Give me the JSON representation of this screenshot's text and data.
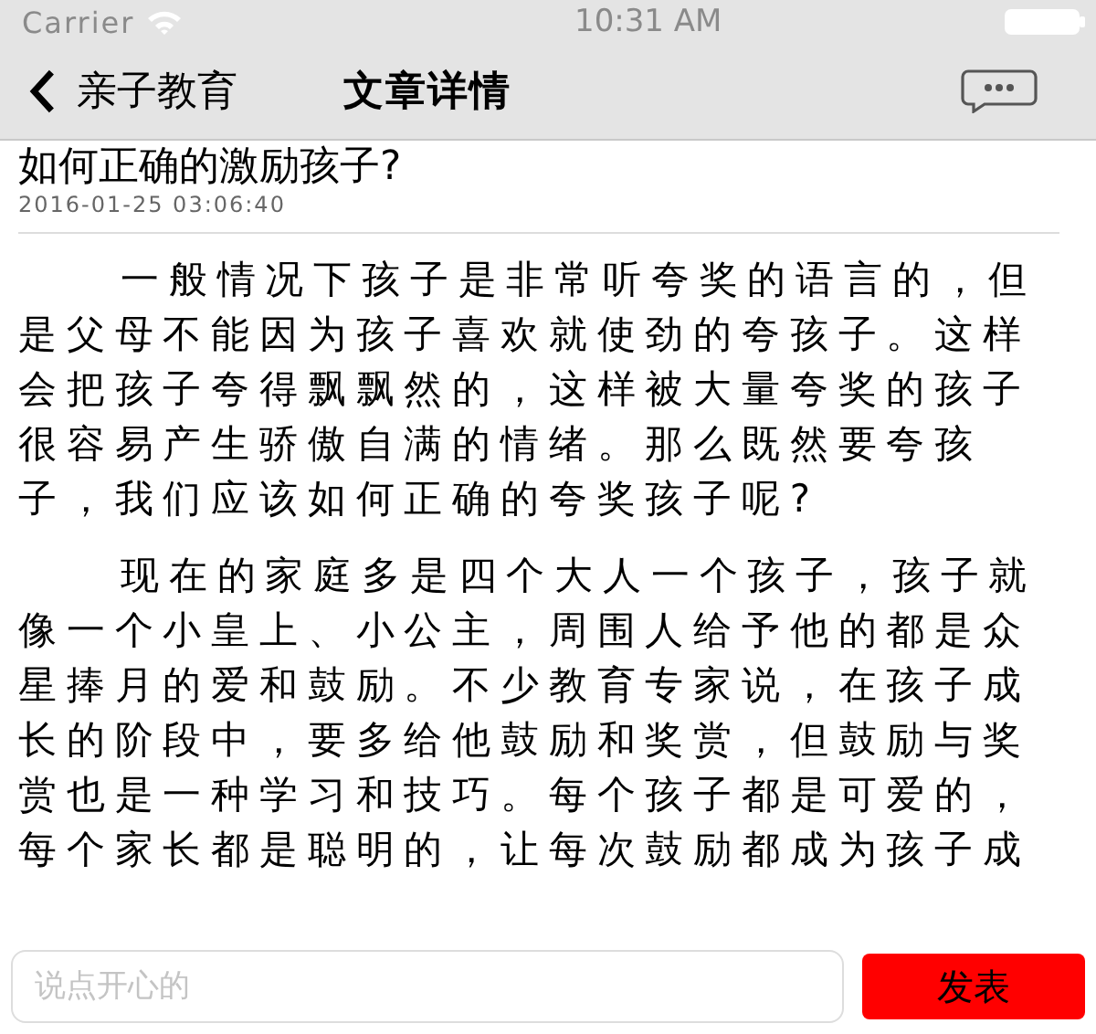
{
  "status_bar": {
    "carrier": "Carrier",
    "time": "10:31 AM"
  },
  "nav_bar": {
    "back_label": "亲子教育",
    "title": "文章详情"
  },
  "article": {
    "title": "如何正确的激励孩子?",
    "date": "2016-01-25 03:06:40",
    "paragraphs": [
      "一般情况下孩子是非常听夸奖的语言的，但是父母不能因为孩子喜欢就使劲的夸孩子。这样会把孩子夸得飘飘然的，这样被大量夸奖的孩子很容易产生骄傲自满的情绪。那么既然要夸孩子，我们应该如何正确的夸奖孩子呢?",
      "现在的家庭多是四个大人一个孩子，孩子就像一个小皇上、小公主，周围人给予他的都是众星捧月的爱和鼓励。不少教育专家说，在孩子成长的阶段中，要多给他鼓励和奖赏，但鼓励与奖赏也是一种学习和技巧。每个孩子都是可爱的，每个家长都是聪明的，让每次鼓励都成为孩子成"
    ]
  },
  "comment_bar": {
    "placeholder": "说点开心的",
    "submit": "发表"
  }
}
